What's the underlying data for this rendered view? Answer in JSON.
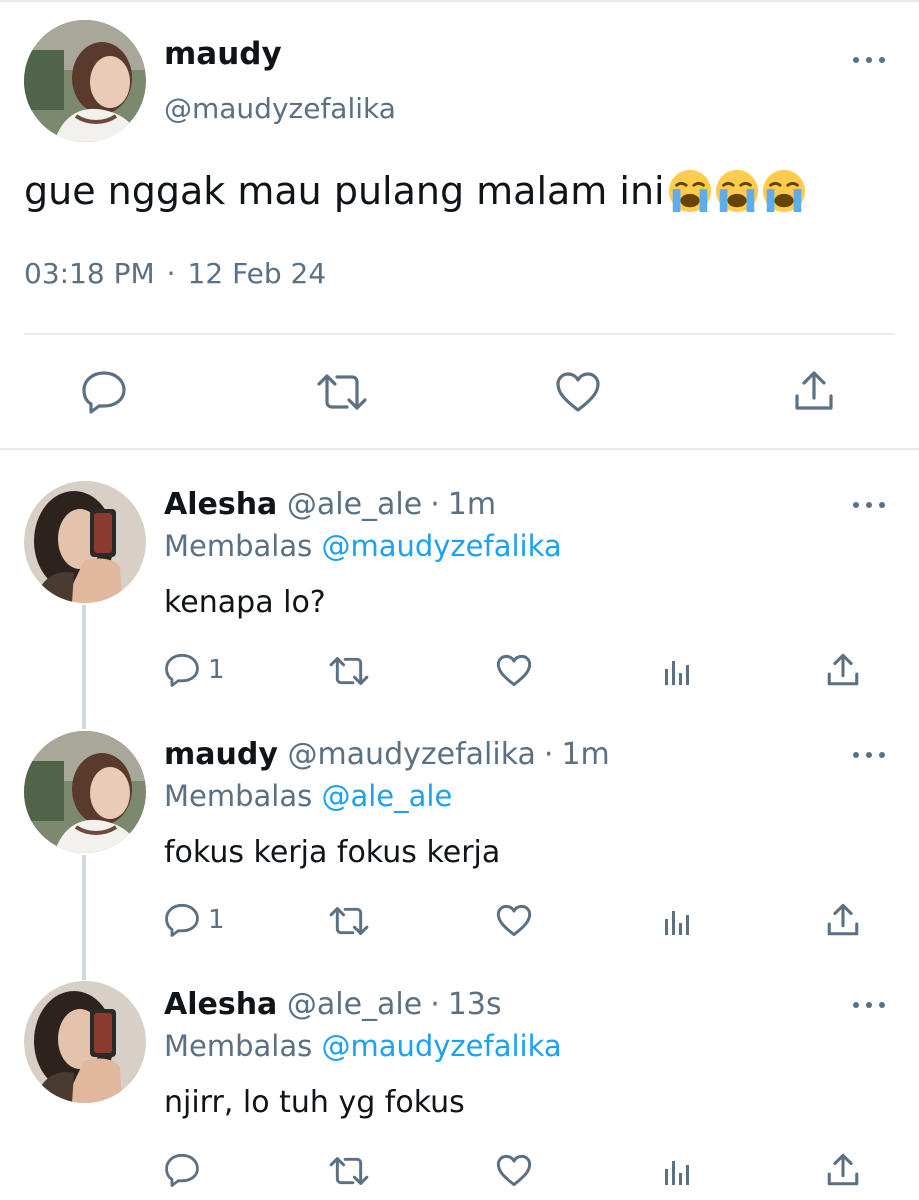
{
  "main_tweet": {
    "name": "maudy",
    "handle": "@maudyzefalika",
    "text": "gue nggak mau pulang malam ini",
    "emojis": [
      "loudly-crying-face",
      "loudly-crying-face",
      "loudly-crying-face"
    ],
    "time": "03:18 PM",
    "separator": "·",
    "date": "12 Feb 24",
    "actions": [
      "reply-icon",
      "retweet-icon",
      "like-icon",
      "share-icon"
    ]
  },
  "replies": [
    {
      "name": "Alesha",
      "handle": "@ale_ale",
      "separator": "·",
      "time": "1m",
      "reply_prefix": "Membalas",
      "reply_to": "@maudyzefalika",
      "text": "kenapa lo?",
      "reply_count": "1"
    },
    {
      "name": "maudy",
      "handle": "@maudyzefalika",
      "separator": "·",
      "time": "1m",
      "reply_prefix": "Membalas",
      "reply_to": "@ale_ale",
      "text": "fokus kerja fokus kerja",
      "reply_count": "1"
    },
    {
      "name": "Alesha",
      "handle": "@ale_ale",
      "separator": "·",
      "time": "13s",
      "reply_prefix": "Membalas",
      "reply_to": "@maudyzefalika",
      "text": "njirr, lo tuh yg fokus",
      "reply_count": ""
    }
  ],
  "colors": {
    "text_primary": "#0f1419",
    "text_secondary": "#5b7083",
    "mention": "#1da1f2",
    "divider": "#e6ecf0",
    "thread_line": "#cfd9de"
  }
}
